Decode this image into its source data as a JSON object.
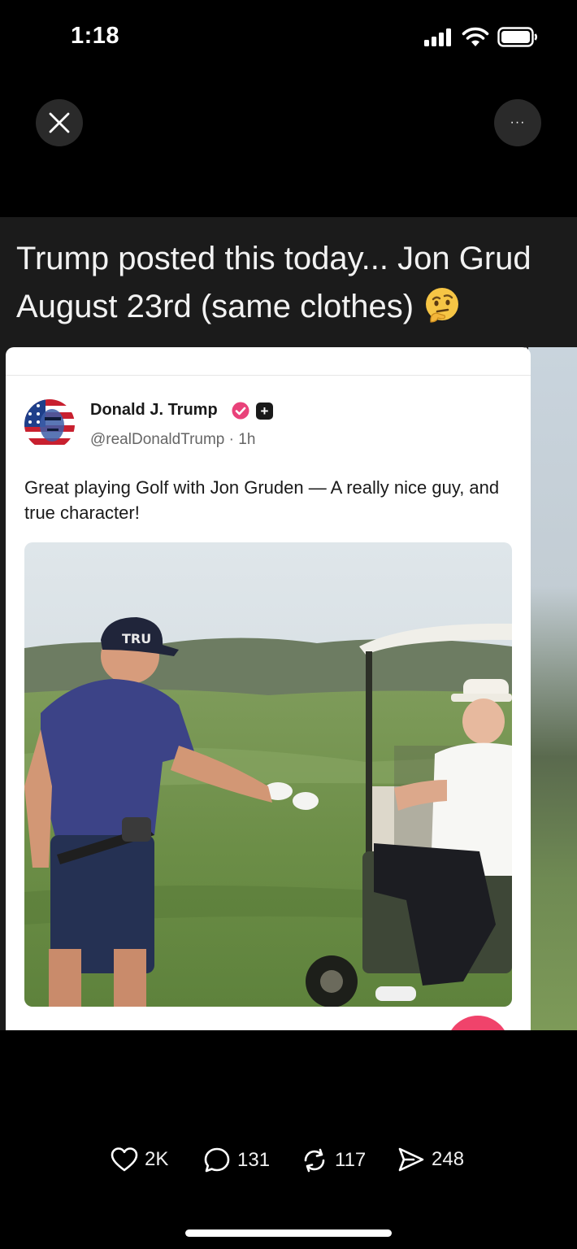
{
  "status": {
    "time": "1:18",
    "icons": [
      "signal-icon",
      "wifi-icon",
      "battery-icon"
    ]
  },
  "toolbar": {
    "close_icon": "close-icon",
    "more_label": "···"
  },
  "post": {
    "caption_line1": "Trump posted this today... Jon Grud",
    "caption_line2": "August 23rd (same clothes)",
    "caption_emoji": "thinking-face-emoji",
    "card": {
      "author": "Donald J. Trump",
      "handle": "@realDonaldTrump · 1h",
      "plus": "+",
      "text": "Great playing Golf with Jon Gruden — A really nice guy, and true character!",
      "cap_text": "TRU"
    }
  },
  "actions": {
    "likes": "2K",
    "comments": "131",
    "reposts": "117",
    "shares": "248"
  },
  "colors": {
    "background": "#000000",
    "verified": "#e9427a",
    "accent_pink": "#f0436b"
  }
}
